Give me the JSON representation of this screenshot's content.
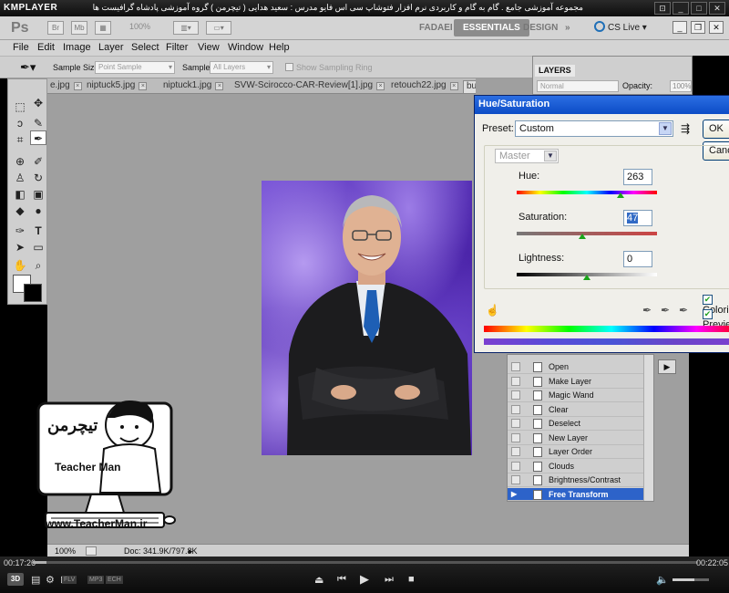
{
  "player": {
    "logo": "KMPLAYER",
    "caption": "مجموعه آموزشی جامع . گام به گام و کاربردی نرم افزار فتوشاپ سی اس فایو  مدرس : سعید هدایی ( تیچرمن ) گروه آموزشی پادشاه گرافیست ها",
    "time_elapsed": "00:17:26",
    "time_total": "00:22:05",
    "progress_fraction": 0.02,
    "volume_fraction": 0.6,
    "badges": [
      "3D",
      "FLV",
      "MP3",
      "ECH"
    ]
  },
  "photoshop": {
    "logo": "Ps",
    "zoom_select": "100%",
    "workspaces": [
      "FADAEI",
      "ESSENTIALS",
      "DESIGN"
    ],
    "active_workspace": "ESSENTIALS",
    "cs_live": "CS Live",
    "menu": [
      "File",
      "Edit",
      "Image",
      "Layer",
      "Select",
      "Filter",
      "View",
      "Window",
      "Help"
    ],
    "options": {
      "sample_size_label": "Sample Size:",
      "sample_size_value": "Point Sample",
      "sample_label": "Sample:",
      "sample_value": "All Layers",
      "show_ring_label": "Show Sampling Ring"
    },
    "tabs": [
      "e.jpg",
      "niptuck5.jpg",
      "niptuck1.jpg",
      "SVW-Scirocco-CAR-Review[1].jpg",
      "retouch22.jpg",
      "businessman.jpg"
    ],
    "active_tab": "businessman.jpg",
    "status": {
      "zoom": "100%",
      "doc_info": "Doc: 341.9K/797.8K"
    },
    "layers": {
      "title": "LAYERS",
      "blend": "Normal",
      "opacity_label": "Opacity:",
      "opacity_value": "100%"
    },
    "history": {
      "items": [
        "Open",
        "Make Layer",
        "Magic Wand",
        "Clear",
        "Deselect",
        "New Layer",
        "Layer Order",
        "Clouds",
        "Brightness/Contrast",
        "Free Transform"
      ],
      "selected": "Free Transform"
    }
  },
  "dialog": {
    "title": "Hue/Saturation",
    "preset_label": "Preset:",
    "preset_value": "Custom",
    "channel": "Master",
    "hue_label": "Hue:",
    "hue_value": "263",
    "hue_position": 0.74,
    "saturation_label": "Saturation:",
    "saturation_value": "47",
    "saturation_position": 0.465,
    "lightness_label": "Lightness:",
    "lightness_value": "0",
    "lightness_position": 0.5,
    "ok_label": "OK",
    "cancel_label": "Cancel",
    "colorize_label": "Colorize",
    "preview_label": "Preview",
    "colorize_checked": true,
    "preview_checked": true
  },
  "watermark": {
    "brand": "Teacher Man",
    "url": "www.TeacherMan.ir"
  },
  "colors": {
    "ps_bg": "#9f9f9f",
    "dialog_title": "#0c4cc6",
    "history_selected": "#2d63c9"
  }
}
